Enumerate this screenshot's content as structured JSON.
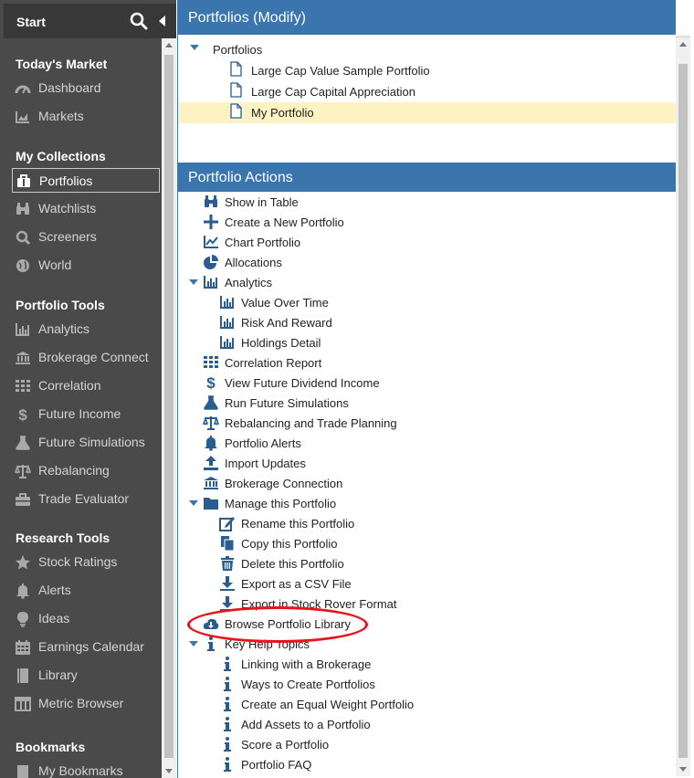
{
  "sidebar": {
    "title": "Start",
    "sections": [
      {
        "title": "Today's Market",
        "items": [
          {
            "label": "Dashboard",
            "icon": "dashboard-icon"
          },
          {
            "label": "Markets",
            "icon": "area-chart-icon"
          }
        ]
      },
      {
        "title": "My Collections",
        "items": [
          {
            "label": "Portfolios",
            "icon": "briefcase-icon",
            "active": true
          },
          {
            "label": "Watchlists",
            "icon": "binoculars-icon"
          },
          {
            "label": "Screeners",
            "icon": "search-icon"
          },
          {
            "label": "World",
            "icon": "globe-icon"
          }
        ]
      },
      {
        "title": "Portfolio Tools",
        "items": [
          {
            "label": "Analytics",
            "icon": "bar-chart-icon"
          },
          {
            "label": "Brokerage Connect",
            "icon": "bank-icon"
          },
          {
            "label": "Correlation",
            "icon": "grid-icon"
          },
          {
            "label": "Future Income",
            "icon": "dollar-icon"
          },
          {
            "label": "Future Simulations",
            "icon": "flask-icon"
          },
          {
            "label": "Rebalancing",
            "icon": "balance-scale-icon"
          },
          {
            "label": "Trade Evaluator",
            "icon": "toolbox-icon"
          }
        ]
      },
      {
        "title": "Research Tools",
        "items": [
          {
            "label": "Stock Ratings",
            "icon": "star-icon"
          },
          {
            "label": "Alerts",
            "icon": "bell-icon"
          },
          {
            "label": "Ideas",
            "icon": "lightbulb-icon"
          },
          {
            "label": "Earnings Calendar",
            "icon": "calendar-icon"
          },
          {
            "label": "Library",
            "icon": "book-icon"
          },
          {
            "label": "Metric Browser",
            "icon": "columns-icon"
          }
        ]
      },
      {
        "title": "Bookmarks",
        "items": [
          {
            "label": "My Bookmarks",
            "icon": "bookmark-icon"
          }
        ]
      }
    ]
  },
  "portfolios_panel": {
    "title": "Portfolios (Modify)",
    "root_label": "Portfolios",
    "items": [
      {
        "label": "Large Cap Value Sample Portfolio",
        "selected": false
      },
      {
        "label": "Large Cap Capital Appreciation",
        "selected": false
      },
      {
        "label": "My Portfolio",
        "selected": true
      }
    ]
  },
  "actions_panel": {
    "title": "Portfolio Actions",
    "items": [
      {
        "label": "Show in Table",
        "icon": "binoculars-icon",
        "level": 0
      },
      {
        "label": "Create a New Portfolio",
        "icon": "plus-icon",
        "level": 0
      },
      {
        "label": "Chart Portfolio",
        "icon": "line-chart-icon",
        "level": 0
      },
      {
        "label": "Allocations",
        "icon": "pie-chart-icon",
        "level": 0
      },
      {
        "label": "Analytics",
        "icon": "bar-chart-icon",
        "level": 0,
        "expanded": true
      },
      {
        "label": "Value Over Time",
        "icon": "bar-chart-icon",
        "level": 1
      },
      {
        "label": "Risk And Reward",
        "icon": "bar-chart-icon",
        "level": 1
      },
      {
        "label": "Holdings Detail",
        "icon": "bar-chart-icon",
        "level": 1
      },
      {
        "label": "Correlation Report",
        "icon": "grid-icon",
        "level": 0
      },
      {
        "label": "View Future Dividend Income",
        "icon": "dollar-icon",
        "level": 0
      },
      {
        "label": "Run Future Simulations",
        "icon": "flask-icon",
        "level": 0
      },
      {
        "label": "Rebalancing and Trade Planning",
        "icon": "balance-scale-icon",
        "level": 0
      },
      {
        "label": "Portfolio Alerts",
        "icon": "bell-icon",
        "level": 0
      },
      {
        "label": "Import Updates",
        "icon": "upload-icon",
        "level": 0
      },
      {
        "label": "Brokerage Connection",
        "icon": "bank-icon",
        "level": 0
      },
      {
        "label": "Manage this Portfolio",
        "icon": "folder-icon",
        "level": 0,
        "expanded": true
      },
      {
        "label": "Rename this Portfolio",
        "icon": "edit-icon",
        "level": 1
      },
      {
        "label": "Copy this Portfolio",
        "icon": "copy-icon",
        "level": 1
      },
      {
        "label": "Delete this Portfolio",
        "icon": "trash-icon",
        "level": 1
      },
      {
        "label": "Export as a CSV File",
        "icon": "download-icon",
        "level": 1
      },
      {
        "label": "Export in Stock Rover Format",
        "icon": "download-icon",
        "level": 1
      },
      {
        "label": "Browse Portfolio Library",
        "icon": "cloud-download-icon",
        "level": 0,
        "highlighted": true
      },
      {
        "label": "Key Help Topics",
        "icon": "info-icon",
        "level": 0,
        "expanded": true
      },
      {
        "label": "Linking with a Brokerage",
        "icon": "info-icon",
        "level": 1
      },
      {
        "label": "Ways to Create Portfolios",
        "icon": "info-icon",
        "level": 1
      },
      {
        "label": "Create an Equal Weight Portfolio",
        "icon": "info-icon",
        "level": 1
      },
      {
        "label": "Add Assets to a Portfolio",
        "icon": "info-icon",
        "level": 1
      },
      {
        "label": "Score a Portfolio",
        "icon": "info-icon",
        "level": 1
      },
      {
        "label": "Portfolio FAQ",
        "icon": "info-icon",
        "level": 1
      }
    ]
  },
  "colors": {
    "sidebar_bg": "#4a4a4a",
    "sidebar_header_bg": "#383838",
    "panel_title_bg": "#3a75ae",
    "selected_row_bg": "#fdf2c2",
    "icon_blue": "#2a5d8f",
    "annotation_red": "#e8131b"
  }
}
